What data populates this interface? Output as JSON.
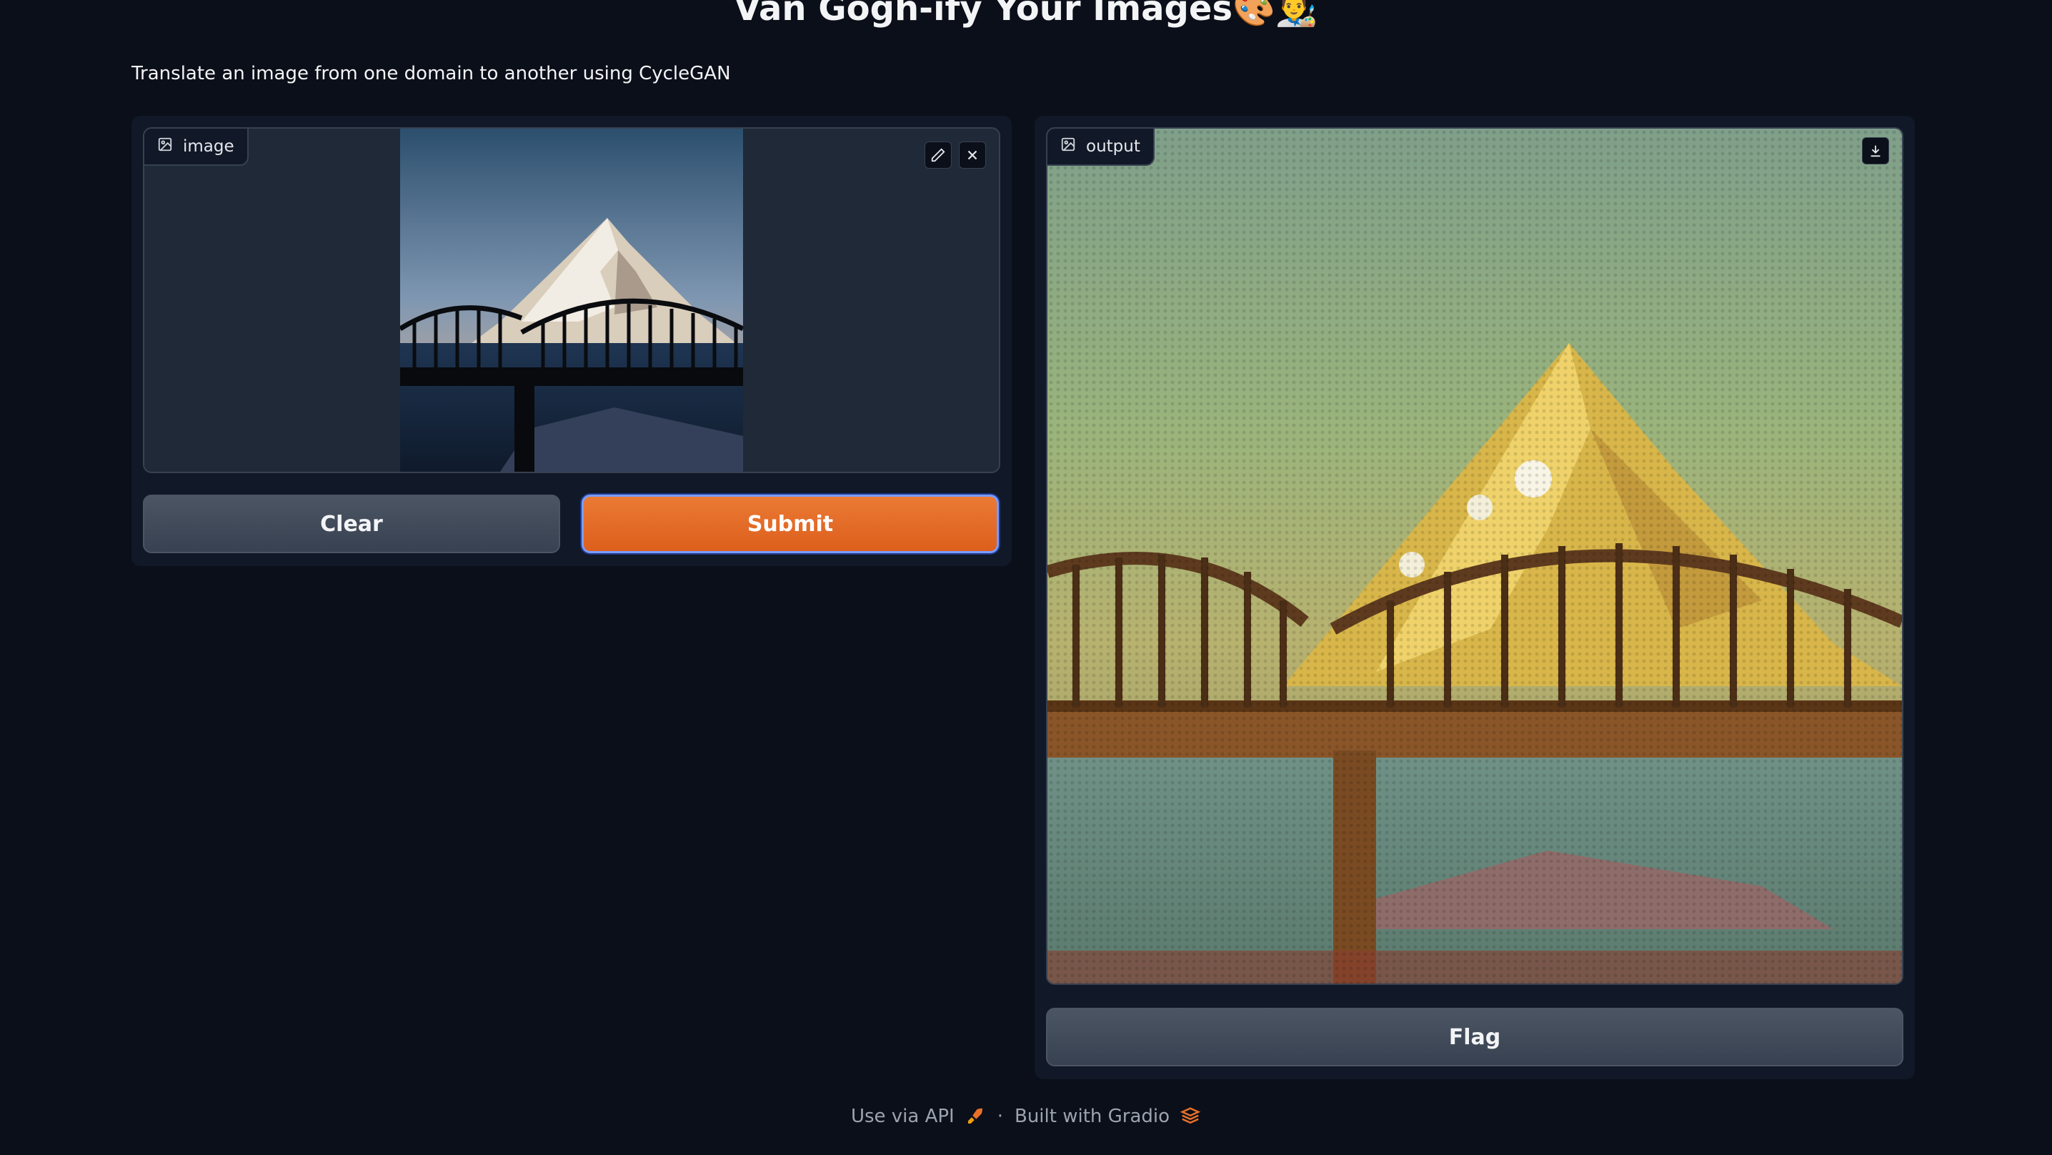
{
  "header": {
    "title": "Van Gogh-ify Your Images🎨👨‍🎨",
    "description": "Translate an image from one domain to another using CycleGAN"
  },
  "input": {
    "label": "image",
    "icon": "image-icon",
    "actions": [
      "edit-icon",
      "close-icon"
    ]
  },
  "output": {
    "label": "output",
    "icon": "image-icon",
    "actions": [
      "download-icon"
    ]
  },
  "buttons": {
    "clear": "Clear",
    "submit": "Submit",
    "flag": "Flag"
  },
  "footer": {
    "api": "Use via API",
    "separator": "·",
    "built": "Built with Gradio"
  },
  "colors": {
    "background": "#0b0f19",
    "panel": "#111827",
    "primary": "#e8702a",
    "secondary": "#4b5563"
  }
}
